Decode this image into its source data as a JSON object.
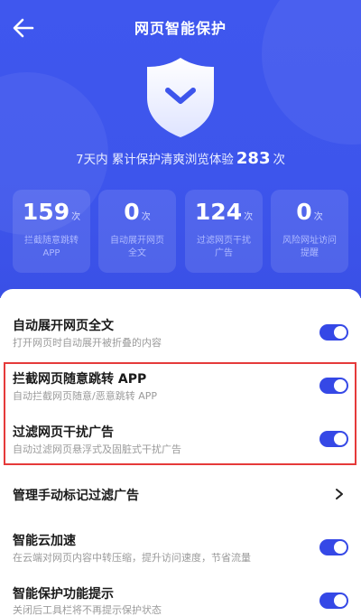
{
  "header": {
    "title": "网页智能保护"
  },
  "summary": {
    "prefix": "7天内 累计保护清爽浏览体验",
    "count": "283",
    "suffix": "次"
  },
  "stats": [
    {
      "value": "159",
      "unit": "次",
      "desc": "拦截随意跳转APP"
    },
    {
      "value": "0",
      "unit": "次",
      "desc": "自动展开网页全文"
    },
    {
      "value": "124",
      "unit": "次",
      "desc": "过滤网页干扰广告"
    },
    {
      "value": "0",
      "unit": "次",
      "desc": "风险网址访问提醒"
    }
  ],
  "settings": [
    {
      "title": "自动展开网页全文",
      "subtitle": "打开网页时自动展开被折叠的内容",
      "enabled": true
    },
    {
      "title": "拦截网页随意跳转 APP",
      "subtitle": "自动拦截网页随意/恶意跳转 APP",
      "enabled": true
    },
    {
      "title": "过滤网页干扰广告",
      "subtitle": "自动过滤网页悬浮式及固脏式干扰广告",
      "enabled": true
    },
    {
      "title": "管理手动标记过滤广告"
    },
    {
      "title": "智能云加速",
      "subtitle": "在云端对网页内容中转压缩，提升访问速度，节省流量",
      "enabled": true
    },
    {
      "title": "智能保护功能提示",
      "subtitle": "关闭后工具栏将不再提示保护状态",
      "enabled": true
    }
  ],
  "colors": {
    "hero": "#3f57ee",
    "accent": "#3548e6",
    "highlight": "#e53a3a"
  }
}
